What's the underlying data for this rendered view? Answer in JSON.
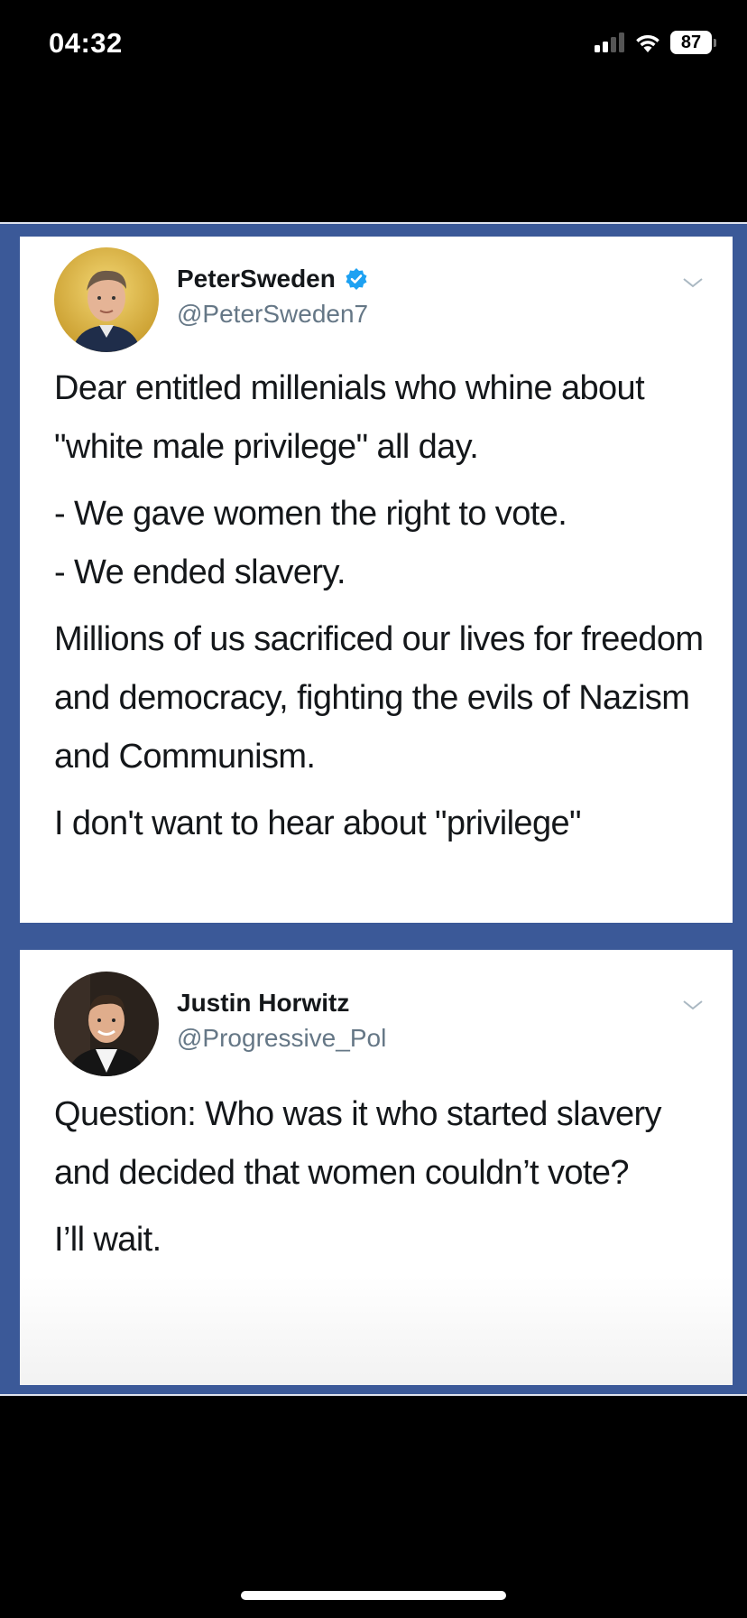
{
  "status_bar": {
    "time": "04:32",
    "battery": "87",
    "icons": [
      "cellular-signal-icon",
      "wifi-icon",
      "battery-icon"
    ]
  },
  "colors": {
    "frame_blue": "#3b5998",
    "verified_blue": "#1da1f2",
    "text": "#14171a",
    "handle_gray": "#657786"
  },
  "tweets": [
    {
      "display_name": "PeterSweden",
      "handle": "@PeterSweden7",
      "verified": true,
      "paragraphs": [
        "Dear entitled millenials who whine about \"white male privilege\" all day.",
        "- We gave women the right to vote.",
        "- We ended slavery.",
        "Millions of us sacrificed our lives for freedom and democracy, fighting the evils of Nazism and Communism.",
        "I don't want to hear about \"privilege\""
      ]
    },
    {
      "display_name": "Justin Horwitz",
      "handle": "@Progressive_Pol",
      "verified": false,
      "paragraphs": [
        "Question: Who was it who started slavery and decided that women couldn’t vote?",
        "I’ll wait."
      ]
    }
  ]
}
